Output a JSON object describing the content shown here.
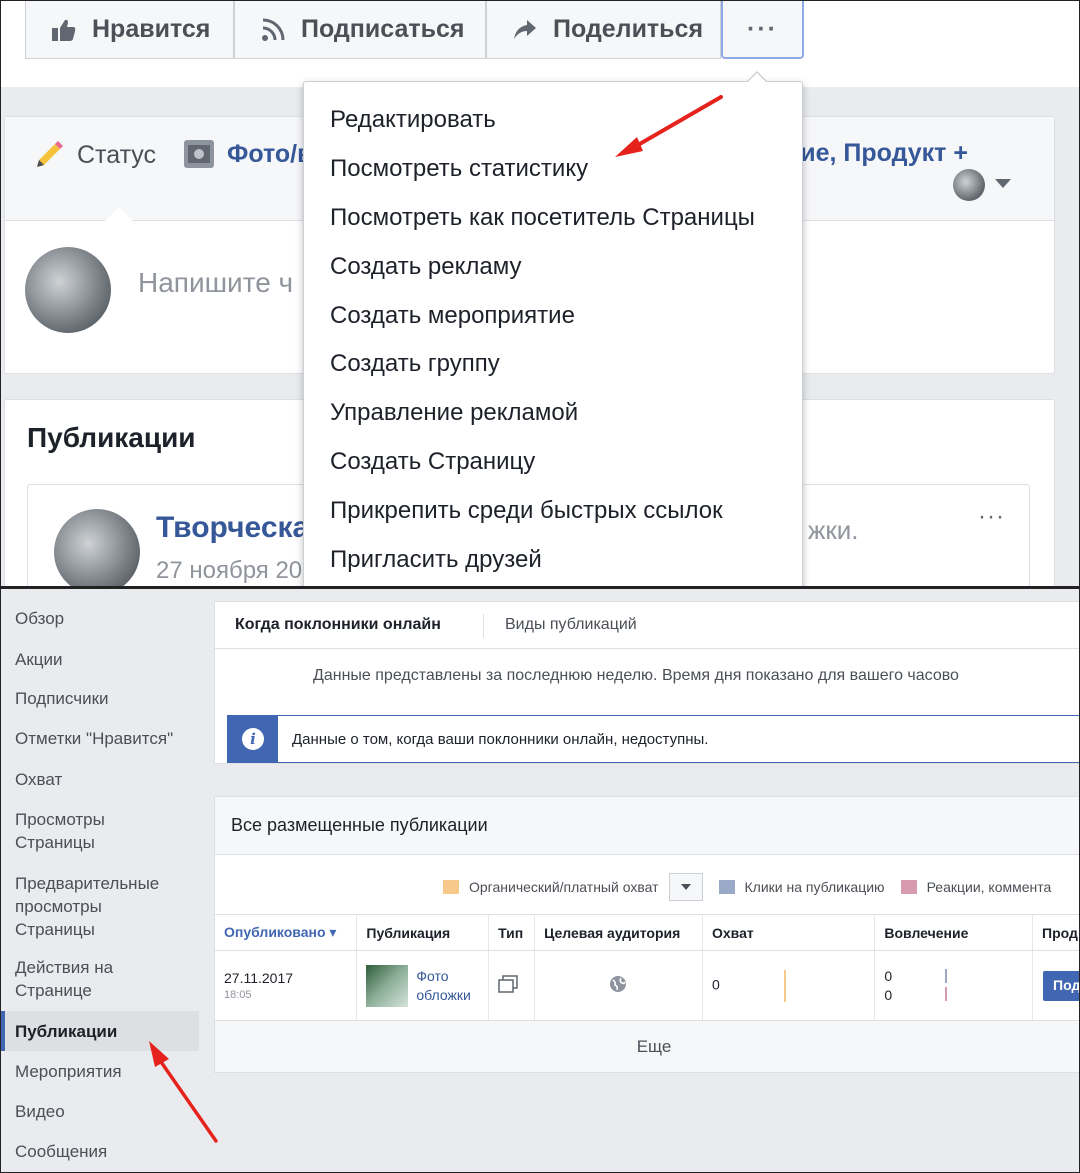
{
  "top": {
    "actions": {
      "like": "Нравится",
      "subscribe": "Подписаться",
      "share": "Поделиться",
      "more": "···"
    },
    "composer": {
      "tab_status": "Статус",
      "tab_photo": "Фото/в",
      "tab_event_product": "тие, Продукт +",
      "placeholder": "Напишите ч"
    },
    "publications": {
      "heading": "Публикации",
      "author": "Творческа",
      "date": "27 ноября 20",
      "text_fragment": "жки.",
      "more": "···"
    },
    "menu": [
      "Редактировать",
      "Посмотреть статистику",
      "Посмотреть как посетитель Страницы",
      "Создать рекламу",
      "Создать мероприятие",
      "Создать группу",
      "Управление рекламой",
      "Создать Страницу",
      "Прикрепить среди быстрых ссылок",
      "Пригласить друзей"
    ]
  },
  "bottom": {
    "sidebar": [
      "Обзор",
      "Акции",
      "Подписчики",
      "Отметки \"Нравится\"",
      "Охват",
      "Просмотры Страницы",
      "Предварительные просмотры Страницы",
      "Действия на Странице",
      "Публикации",
      "Мероприятия",
      "Видео",
      "Сообщения"
    ],
    "active_item": "Публикации",
    "tabs": {
      "online": "Когда поклонники онлайн",
      "types": "Виды публикаций"
    },
    "note": "Данные представлены за последнюю неделю. Время дня показано для вашего часово",
    "info": "Данные о том, когда ваши поклонники онлайн, недоступны.",
    "all_posts_title": "Все размещенные публикации",
    "legend": {
      "organic": "Органический/платный охват",
      "clicks": "Клики на публикацию",
      "reactions": "Реакции, коммента",
      "organic_color": "#f7c98b",
      "clicks_color": "#99a9c7",
      "reactions_color": "#d79aaf"
    },
    "table": {
      "headers": [
        "Опубликовано ▾",
        "Публикация",
        "Тип",
        "Целевая аудитория",
        "Охват",
        "Вовлечение",
        "Прод"
      ],
      "row": {
        "date": "27.11.2017",
        "time": "18:05",
        "publication": "Фото обложки",
        "reach": "0",
        "engagement_1": "0",
        "engagement_2": "0",
        "promote": "Под"
      }
    },
    "more": "Еще"
  },
  "colors": {
    "fb_blue": "#4267b2",
    "link": "#365899",
    "arrow_red": "#e5221c"
  }
}
